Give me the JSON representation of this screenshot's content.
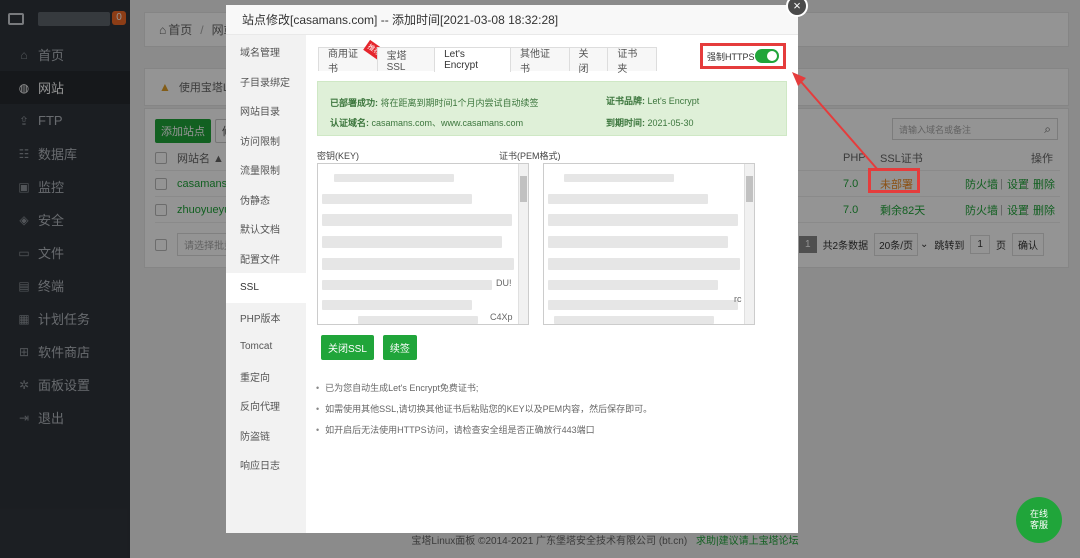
{
  "sidebar": {
    "badge": "0",
    "items": [
      {
        "label": "首页",
        "icon": "home-icon",
        "glyph": "⌂"
      },
      {
        "label": "网站",
        "icon": "globe-icon",
        "glyph": "◍"
      },
      {
        "label": "FTP",
        "icon": "ftp-icon",
        "glyph": "⇪"
      },
      {
        "label": "数据库",
        "icon": "database-icon",
        "glyph": "☷"
      },
      {
        "label": "监控",
        "icon": "monitor-icon",
        "glyph": "▣"
      },
      {
        "label": "安全",
        "icon": "shield-icon",
        "glyph": "◈"
      },
      {
        "label": "文件",
        "icon": "folder-icon",
        "glyph": "▭"
      },
      {
        "label": "终端",
        "icon": "terminal-icon",
        "glyph": "▤"
      },
      {
        "label": "计划任务",
        "icon": "calendar-icon",
        "glyph": "▦"
      },
      {
        "label": "软件商店",
        "icon": "apps-icon",
        "glyph": "⊞"
      },
      {
        "label": "面板设置",
        "icon": "gear-icon",
        "glyph": "✲"
      },
      {
        "label": "退出",
        "icon": "logout-icon",
        "glyph": "⇥"
      }
    ]
  },
  "breadcrumb": {
    "home": "首页",
    "sep": "/",
    "current": "网站"
  },
  "warning": "使用宝塔Linu",
  "panel": {
    "add_site": "添加站点",
    "second_btn": "修",
    "search_placeholder": "请输入域名或备注",
    "col_sitename": "网站名 ▲",
    "col_php": "PHP",
    "col_ssl": "SSL证书",
    "col_ops": "操作",
    "rows": [
      {
        "name": "casamans.",
        "php": "7.0",
        "ssl": "未部署",
        "firewall": "防火墙",
        "settings": "设置",
        "delete": "删除"
      },
      {
        "name": "zhuoyueyu",
        "php": "7.0",
        "ssl": "剩余82天",
        "firewall": "防火墙",
        "settings": "设置",
        "delete": "删除"
      }
    ],
    "batch_placeholder": "请选择批量",
    "pager": {
      "page": "1",
      "total": "共2条数据",
      "per_page": "20条/页",
      "goto": "跳转到",
      "goto_value": "1",
      "page_unit": "页",
      "confirm": "确认"
    }
  },
  "footer": {
    "text": "宝塔Linux面板 ©2014-2021 广东堡塔安全技术有限公司 (bt.cn)",
    "link": "求助|建议请上宝塔论坛"
  },
  "modal": {
    "title": "站点修改[casamans.com] -- 添加时间[2021-03-08 18:32:28]",
    "close": "×",
    "side_items": [
      "域名管理",
      "子目录绑定",
      "网站目录",
      "访问限制",
      "流量限制",
      "伪静态",
      "默认文档",
      "配置文件",
      "SSL",
      "PHP版本",
      "Tomcat",
      "重定向",
      "反向代理",
      "防盗链",
      "响应日志"
    ],
    "tabs": [
      "商用证书",
      "宝塔SSL",
      "Let's Encrypt",
      "其他证书",
      "关闭",
      "证书夹"
    ],
    "recommend_badge": "推荐",
    "force_https": "强制HTTPS",
    "force_https_on": true,
    "info": {
      "deployed_label": "已部署成功:",
      "deployed_value": "将在距离到期时间1个月内尝试自动续签",
      "domain_label": "认证域名:",
      "domain_value": "casamans.com、www.casamans.com",
      "brand_label": "证书品牌:",
      "brand_value": "Let's Encrypt",
      "expire_label": "到期时间:",
      "expire_value": "2021-05-30"
    },
    "key_label": "密钥(KEY)",
    "cert_label": "证书(PEM格式)",
    "key_frag1": "DU!",
    "key_frag2": "C4Xp",
    "cert_frag": "rc",
    "close_ssl": "关闭SSL",
    "renew": "续签",
    "notes": [
      "已为您自动生成Let's Encrypt免费证书;",
      "如需使用其他SSL,请切换其他证书后粘贴您的KEY以及PEM内容，然后保存即可。",
      "如开启后无法使用HTTPS访问，请检查安全组是否正确放行443端口"
    ]
  },
  "chat": {
    "line1": "在线",
    "line2": "客服"
  }
}
